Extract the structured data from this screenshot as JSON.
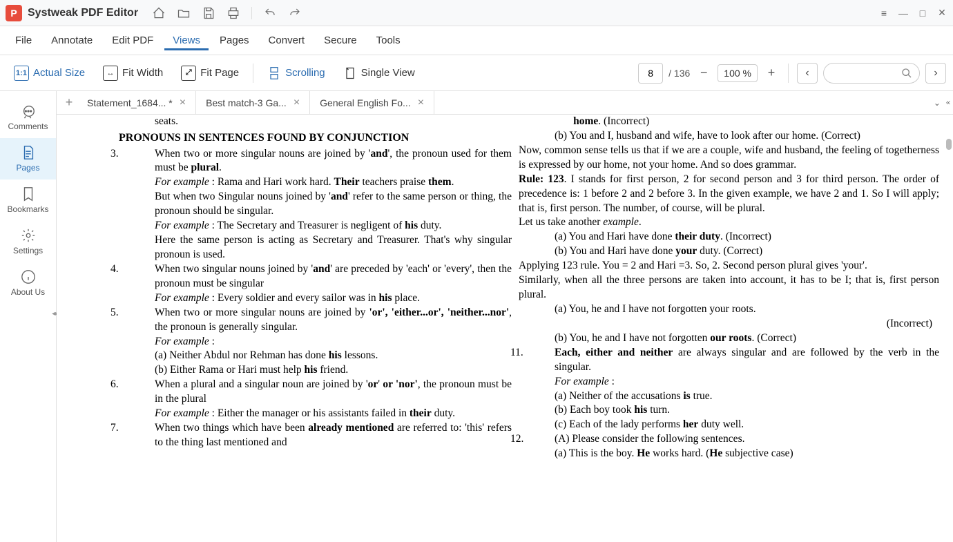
{
  "app": {
    "title": "Systweak PDF Editor",
    "logo_letter": "P"
  },
  "window_controls": {
    "menu": "≡",
    "minimize": "—",
    "maximize": "□",
    "close": "✕"
  },
  "title_icons": {
    "home": "⌂",
    "open": "folder",
    "save": "save",
    "print": "print",
    "undo": "↶",
    "redo": "↷"
  },
  "menu": {
    "items": [
      "File",
      "Annotate",
      "Edit PDF",
      "Views",
      "Pages",
      "Convert",
      "Secure",
      "Tools"
    ],
    "active_index": 3
  },
  "toolbar": {
    "actual_size": "Actual Size",
    "fit_width": "Fit Width",
    "fit_page": "Fit Page",
    "scrolling": "Scrolling",
    "single_view": "Single View",
    "icon_11": "1:1",
    "page_current": "8",
    "page_total": "/ 136",
    "zoom_value": "100 %"
  },
  "sidebar": {
    "items": [
      {
        "label": "Comments",
        "icon": "comment"
      },
      {
        "label": "Pages",
        "icon": "page"
      },
      {
        "label": "Bookmarks",
        "icon": "bookmark"
      },
      {
        "label": "Settings",
        "icon": "gear"
      },
      {
        "label": "About Us",
        "icon": "info"
      }
    ],
    "active_index": 1
  },
  "tabs": {
    "items": [
      {
        "label": "Statement_1684... *"
      },
      {
        "label": "Best match-3 Ga..."
      },
      {
        "label": "General English Fo..."
      }
    ],
    "active_index": 2
  },
  "doc": {
    "seats": "seats.",
    "heading": "PRONOUNS IN SENTENCES FOUND BY CONJUNCTION",
    "p3a": "When two or more singular nouns are joined by '",
    "p3a_b": "and",
    "p3a2": "', the pronoun used for them must be ",
    "p3a_b2": "plural",
    "p3b": "For example",
    "p3b2": " : Rama and Hari work hard. ",
    "p3b_b": "Their",
    "p3b3": " teachers praise ",
    "p3b_b2": "them",
    "p3c": "But when two Singular nouns joined by '",
    "p3c_b": "and",
    "p3c2": "' refer to the same person or thing, the pronoun should be singular.",
    "p3d": " : The Secretary and Treasurer is negligent of ",
    "p3d_b": "his",
    "p3d2": " duty.",
    "p3e": "Here the same person is acting as Secretary and Treasurer. That's why singular pronoun is used.",
    "p4a": "When two singular nouns joined by '",
    "p4a_b": "and",
    "p4a2": "' are preceded by 'each' or 'every', then the pronoun must be singular",
    "p4b": " : Every soldier and every sailor was in ",
    "p4b_b": "his",
    "p4b2": " place.",
    "p5a": "When two or more singular nouns are joined by ",
    "p5a_b": "'or', 'either...or', 'neither...nor'",
    "p5a2": ", the pronoun is generally singular.",
    "p5b": " :",
    "p5c": "(a)   Neither Abdul nor Rehman has done ",
    "p5c_b": "his",
    "p5c2": " lessons.",
    "p5d": "(b)   Either Rama or Hari must help ",
    "p5d_b": "his",
    "p5d2": " friend.",
    "p6a": "When a plural and a singular noun are joined by '",
    "p6a_b": "or",
    "p6a2": "' ",
    "p6a_b2": "or 'nor'",
    "p6a3": ", the pronoun must be in the plural",
    "p6b": " : Either the manager or his assistants failed in ",
    "p6b_b": "their",
    "p6b2": " duty.",
    "p7a": "When two things which have been ",
    "p7a_b": "already mentioned",
    "p7a2": " are referred to: 'this' refers to the thing last mentioned and",
    "r_a1": "home",
    "r_a2": ". (Incorrect)",
    "r_b": "(b)   You and I, husband and wife, have to look after our home. (Correct)",
    "r_c": "Now, common sense tells us that if we are a couple, wife and husband, the feeling of togetherness is expressed by our home, not your home. And so does grammar.",
    "r_d_b": "Rule: 123",
    "r_d": ". I stands for first person, 2 for second person and 3 for third person. The order of precedence is: 1 before 2 and 2 before 3. In the given example, we have 2 and 1. So I will apply; that is, first person. The number, of course, will be plural.",
    "r_e": "Let us take another ",
    "r_e_i": "example",
    "r_f": "(a)   You and Hari have done ",
    "r_f_b": "their duty",
    "r_f2": ". (Incorrect)",
    "r_g": "(b)   You and Hari have done ",
    "r_g_b": "your",
    "r_g2": " duty. (Correct)",
    "r_h": "Applying 123 rule. You = 2 and Hari =3. So, 2. Second person plural gives 'your'.",
    "r_i": "Similarly, when all the three persons are taken into account, it has to be I; that is, first person plural.",
    "r_j": "(a)   You, he and I have not forgotten your roots.",
    "r_j2": "(Incorrect)",
    "r_k": "(b)   You, he and I have not forgotten ",
    "r_k_b": "our roots",
    "r_k2": ". (Correct)",
    "p11a_b": "Each, either and neither",
    "p11a": " are always singular and are followed by the verb in the singular.",
    "p11b": " :",
    "p11c": "(a)   Neither of the accusations ",
    "p11c_b": "is",
    "p11c2": " true.",
    "p11d": "(b)   Each boy took ",
    "p11d_b": "his",
    "p11d2": " turn.",
    "p11e": "(c)   Each of the lady performs ",
    "p11e_b": "her",
    "p11e2": " duty well.",
    "p12a": "(A)  Please consider the following sentences.",
    "p12b": "(a)   This is the boy. ",
    "p12b_b": "He",
    "p12b2": " works hard. (",
    "p12b_b2": "He",
    "p12b3": " subjective case)"
  }
}
